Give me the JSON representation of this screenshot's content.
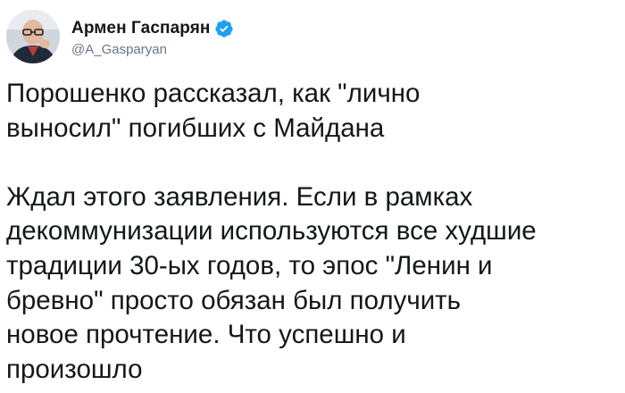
{
  "author": {
    "display_name": "Армен Гаспарян",
    "handle": "@A_Gasparyan",
    "verified": true,
    "avatar_icon": "person-avatar-icon",
    "verified_icon": "verified-badge-icon",
    "verified_color": "#1da1f2"
  },
  "tweet": {
    "text": "Порошенко рассказал, как \"лично\nвыносил\" погибших с Майдана\n\nЖдал этого заявления. Если в рамках\nдекоммунизации используются все худшие\nтрадиции 30-ых годов, то эпос \"Ленин и\nбревно\" просто обязан был получить\nновое прочтение. Что успешно и\nпроизошло"
  }
}
